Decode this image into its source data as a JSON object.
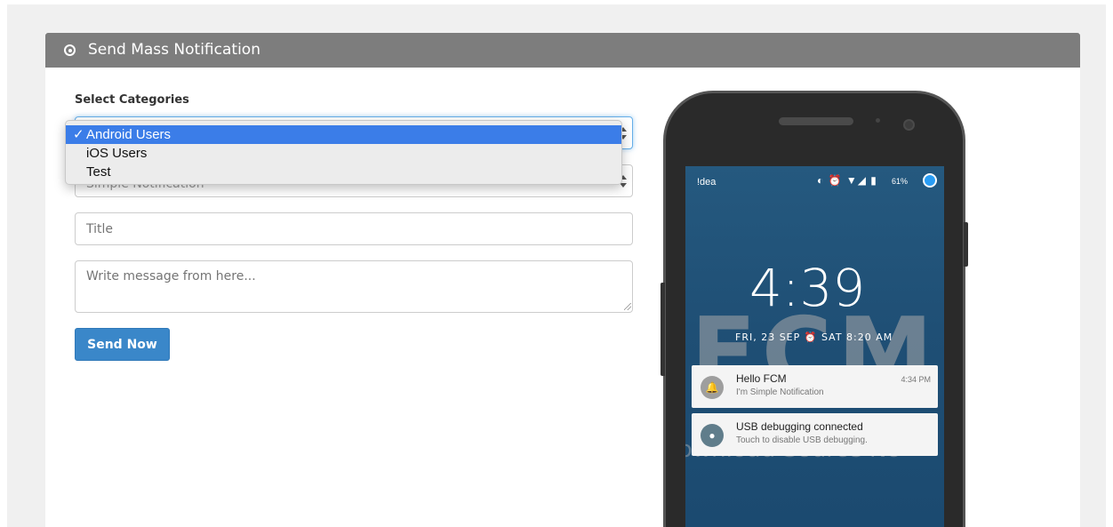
{
  "panel": {
    "title": "Send Mass Notification",
    "icon": "circle-dot-icon",
    "header_color": "#7d7d7d"
  },
  "form": {
    "categories_label": "Select Categories",
    "category_options": [
      "Android Users",
      "iOS Users",
      "Test"
    ],
    "category_selected": "Android Users",
    "type_select_value": "Simple Notification",
    "title_placeholder": "Title",
    "message_placeholder": "Write message from here...",
    "send_label": "Send Now",
    "send_color": "#3a87c9"
  },
  "phone": {
    "carrier": "!dea",
    "status_icons": "◐ ⏰ ▼◢ ▮",
    "battery": "61%",
    "clock": "4:39",
    "date": "FRI, 23 SEP ⏰ SAT 8:20 AM",
    "watermark": "FCM",
    "watermark_sub": "ownload Source No",
    "notifications": [
      {
        "title": "Hello FCM",
        "body": "I'm Simple Notification",
        "time": "4:34 PM",
        "icon": "bell-icon",
        "icon_color": "#9e9e9e"
      },
      {
        "title": "USB debugging connected",
        "body": "Touch to disable USB debugging.",
        "time": "",
        "icon": "android-icon",
        "icon_color": "#607d8b"
      }
    ]
  }
}
